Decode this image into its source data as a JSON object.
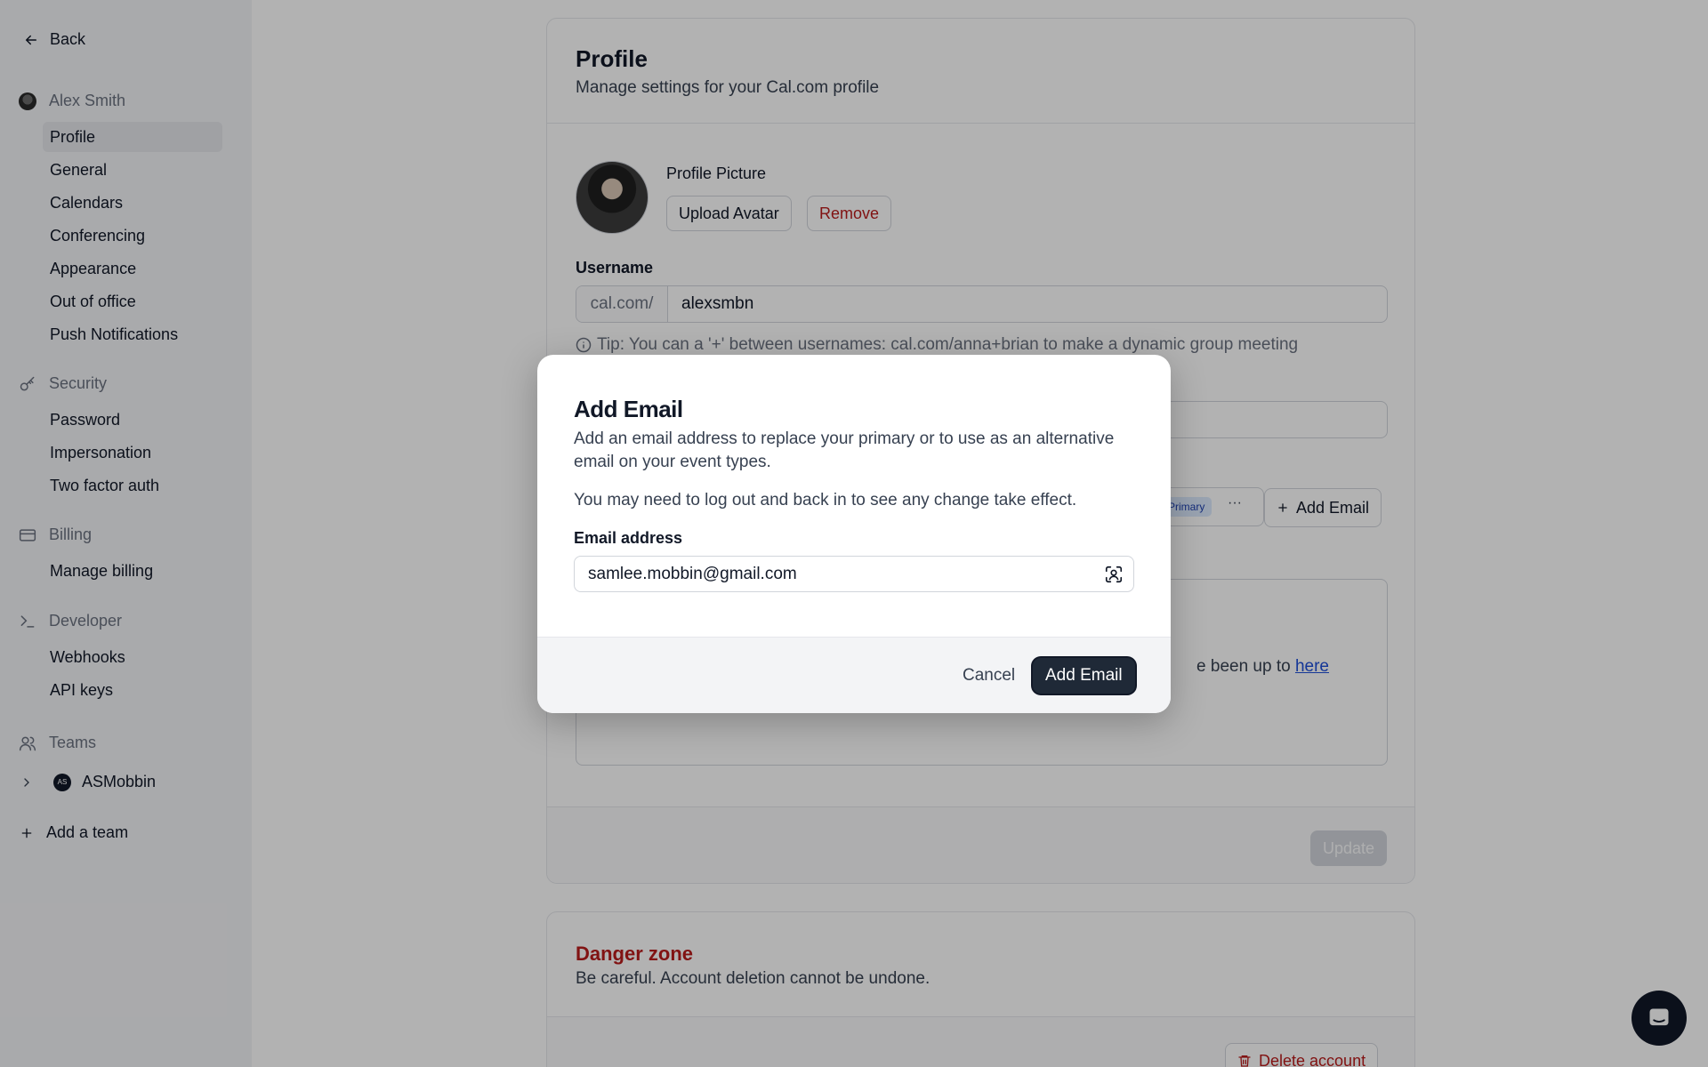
{
  "nav": {
    "back_label": "Back",
    "user_name": "Alex Smith",
    "account_items": [
      "Profile",
      "General",
      "Calendars",
      "Conferencing",
      "Appearance",
      "Out of office",
      "Push Notifications"
    ],
    "security_label": "Security",
    "security_items": [
      "Password",
      "Impersonation",
      "Two factor auth"
    ],
    "billing_label": "Billing",
    "billing_items": [
      "Manage billing"
    ],
    "developer_label": "Developer",
    "developer_items": [
      "Webhooks",
      "API keys"
    ],
    "teams_label": "Teams",
    "team_name": "ASMobbin",
    "team_initials": "AS",
    "add_team_label": "Add a team"
  },
  "profile": {
    "title": "Profile",
    "subtitle": "Manage settings for your Cal.com profile",
    "picture_label": "Profile Picture",
    "upload_label": "Upload Avatar",
    "remove_label": "Remove",
    "username_label": "Username",
    "username_prefix": "cal.com/",
    "username_value": "alexsmbn",
    "tip": "Tip: You can a '+' between usernames: cal.com/anna+brian to make a dynamic group meeting",
    "primary_badge": "Primary",
    "dots": "···",
    "add_email_label": "Add Email",
    "bio_fragment": "e been up to ",
    "bio_link": "here",
    "update_label": "Update"
  },
  "danger": {
    "title": "Danger zone",
    "subtitle": "Be careful. Account deletion cannot be undone.",
    "delete_label": "Delete account"
  },
  "modal": {
    "title": "Add Email",
    "description": "Add an email address to replace your primary or to use as an alternative email on your event types.",
    "note": "You may need to log out and back in to see any change take effect.",
    "email_label": "Email address",
    "email_value": "samlee.mobbin@gmail.com",
    "cancel_label": "Cancel",
    "submit_label": "Add Email"
  },
  "colors": {
    "danger": "#b91c1c",
    "primary_button": "#1f2937",
    "link": "#1d4ed8"
  }
}
